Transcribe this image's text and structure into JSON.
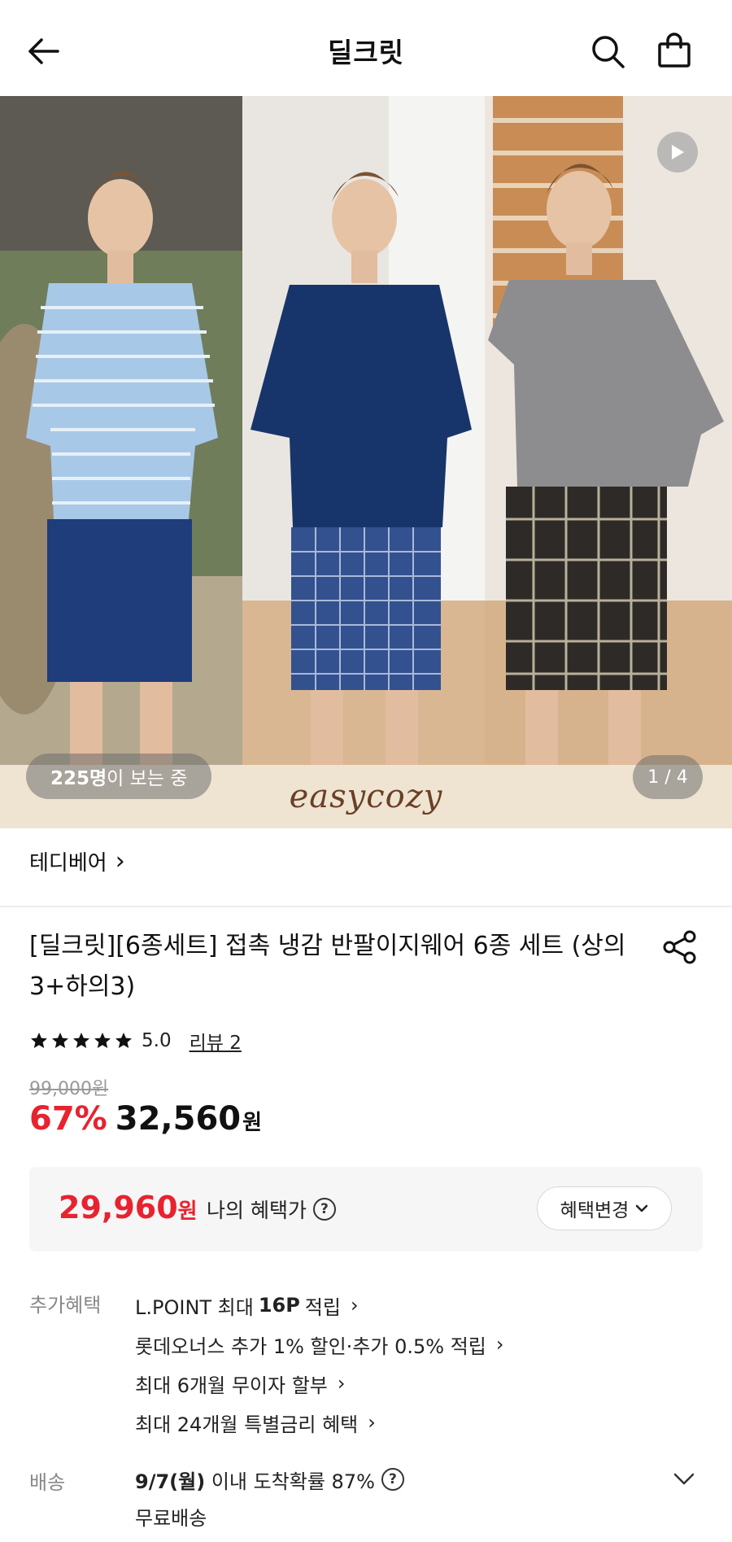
{
  "header": {
    "title": "딜크릿",
    "back_icon": "arrow-left-icon",
    "search_icon": "search-icon",
    "cart_icon": "shopping-bag-icon"
  },
  "hero": {
    "viewers_count": "225명",
    "viewers_suffix": "이 보는 중",
    "pager": "1 / 4",
    "brand_logo": "easycozy",
    "play_icon": "play-icon"
  },
  "brand": {
    "name": "테디베어",
    "chevron": "›"
  },
  "product": {
    "title": "[딜크릿][6종세트] 접촉 냉감 반팔이지웨어 6종 세트 (상의3+하의3)",
    "share_icon": "share-icon",
    "rating_value": "5.0",
    "review_label": "리뷰 2",
    "stars": 5,
    "original_price": "99,000원",
    "discount_percent": "67%",
    "price": "32,560",
    "price_unit": "원"
  },
  "benefit": {
    "price": "29,960",
    "unit": "원",
    "label": "나의 혜택가",
    "help": "?",
    "change_button": "혜택변경"
  },
  "extra": {
    "label": "추가혜택",
    "items": [
      {
        "pre": "L.POINT 최대 ",
        "bold": "16P",
        "post": " 적립"
      },
      {
        "pre": "롯데오너스 추가 1% 할인·추가 0.5% 적립",
        "bold": "",
        "post": ""
      },
      {
        "pre": "최대 6개월 무이자 할부",
        "bold": "",
        "post": ""
      },
      {
        "pre": "최대 24개월 특별금리 혜택",
        "bold": "",
        "post": ""
      }
    ]
  },
  "shipping": {
    "label": "배송",
    "date": "9/7(월)",
    "text": " 이내 도착확률 87%",
    "help": "?",
    "fee": "무료배송"
  },
  "colors": {
    "accent_red": "#e8222f",
    "muted_gray": "#888888"
  }
}
